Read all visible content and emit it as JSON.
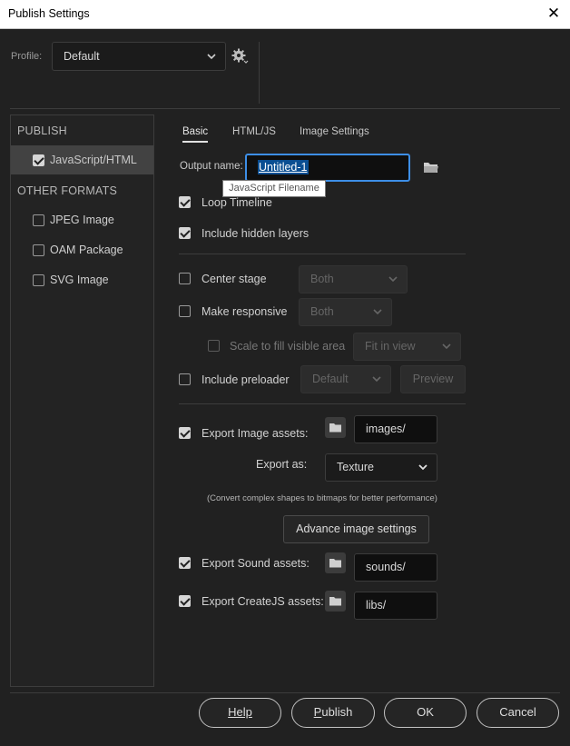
{
  "window": {
    "title": "Publish Settings"
  },
  "profile": {
    "label": "Profile:",
    "value": "Default"
  },
  "sidebar": {
    "publish_heading": "PUBLISH",
    "publish_items": [
      {
        "label": "JavaScript/HTML",
        "checked": true
      }
    ],
    "other_heading": "OTHER FORMATS",
    "other_items": [
      {
        "label": "JPEG Image",
        "checked": false
      },
      {
        "label": "OAM Package",
        "checked": false
      },
      {
        "label": "SVG Image",
        "checked": false
      }
    ]
  },
  "tabs": [
    {
      "label": "Basic",
      "active": true
    },
    {
      "label": "HTML/JS"
    },
    {
      "label": "Image Settings"
    }
  ],
  "output": {
    "label": "Output name:",
    "value": "Untitled-1",
    "tooltip": "JavaScript Filename"
  },
  "options": {
    "loop_timeline": {
      "label": "Loop Timeline",
      "checked": true
    },
    "include_hidden": {
      "label": "Include hidden layers",
      "checked": true
    },
    "center_stage": {
      "label": "Center stage",
      "checked": false,
      "select": "Both"
    },
    "make_responsive": {
      "label": "Make responsive",
      "checked": false,
      "select": "Both"
    },
    "scale_fill": {
      "label": "Scale to fill visible area",
      "checked": false,
      "select": "Fit in view"
    },
    "preloader": {
      "label": "Include preloader",
      "checked": false,
      "select": "Default",
      "preview": "Preview"
    }
  },
  "assets": {
    "image": {
      "label": "Export Image assets:",
      "checked": true,
      "path": "images/"
    },
    "export_as": {
      "label": "Export as:",
      "value": "Texture"
    },
    "note": "(Convert complex shapes to bitmaps for better performance)",
    "advance_button": "Advance image settings",
    "sound": {
      "label": "Export Sound assets:",
      "checked": true,
      "path": "sounds/"
    },
    "createjs": {
      "label": "Export CreateJS assets:",
      "checked": true,
      "path": "libs/"
    }
  },
  "footer": {
    "help": "Help",
    "publish": "Publish",
    "publish_underline": "P",
    "publish_rest": "ublish",
    "ok": "OK",
    "cancel": "Cancel"
  },
  "colors": {
    "selection": "#0a4e92",
    "focus_border": "#3d8ee6"
  }
}
